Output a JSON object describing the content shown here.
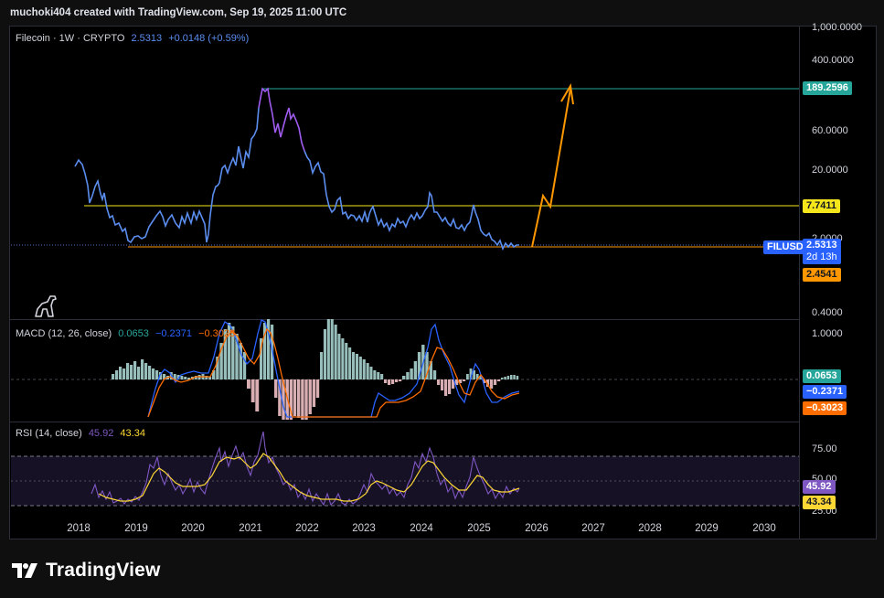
{
  "header": {
    "text": "muchoki404 created with TradingView.com, Sep 19, 2025 11:00 UTC"
  },
  "price_legend": {
    "symbol": "Filecoin · 1W · CRYPTO",
    "price": "2.5313",
    "change": "+0.0148 (+0.59%)"
  },
  "macd_legend": {
    "title": "MACD (12, 26, close)",
    "macd": "0.0653",
    "signal": "−0.2371",
    "hist": "−0.3023"
  },
  "rsi_legend": {
    "title": "RSI (14, close)",
    "rsi": "45.92",
    "ma": "43.34"
  },
  "price_axis": [
    "1,000.0000",
    "400.0000",
    "60.0000",
    "20.0000",
    "2.0000",
    "0.4000"
  ],
  "price_badges": {
    "target": "189.2596",
    "resistance": "7.7411",
    "symbol": "FILUSD",
    "last": "2.5313",
    "countdown": "2d 13h",
    "support": "2.4541"
  },
  "macd_axis": [
    "1.0000"
  ],
  "macd_badges": {
    "macd": "0.0653",
    "signal": "−0.2371",
    "hist": "−0.3023"
  },
  "rsi_axis": [
    "75.00",
    "50.00",
    "25.00"
  ],
  "rsi_badges": {
    "rsi": "45.92",
    "ma": "43.34"
  },
  "time_axis": [
    "2018",
    "2019",
    "2020",
    "2021",
    "2022",
    "2023",
    "2024",
    "2025",
    "2026",
    "2027",
    "2028",
    "2029",
    "2030"
  ],
  "brand": {
    "name": "TradingView"
  },
  "colors": {
    "price_line": "#5b8def",
    "price_line_peak": "#a05cf0",
    "target_line": "#26a69a",
    "resistance_line": "#f5e61c",
    "support_line": "#ff9800",
    "macd_line": "#2962ff",
    "signal_line": "#ff6d00",
    "hist_pos": "#b2dfdb",
    "hist_neg": "#ffcdd2",
    "rsi_line": "#7e57c2",
    "rsi_ma": "#fdd835"
  },
  "chart_data": {
    "type": "line",
    "symbol": "FILUSD",
    "timeframe": "1W",
    "scale": "log",
    "x": [
      "2018-04",
      "2018-07",
      "2018-10",
      "2019-01",
      "2019-04",
      "2019-07",
      "2019-10",
      "2020-01",
      "2020-04",
      "2020-07",
      "2020-10",
      "2021-01",
      "2021-03",
      "2021-04",
      "2021-06",
      "2021-09",
      "2021-11",
      "2022-01",
      "2022-04",
      "2022-07",
      "2022-10",
      "2023-01",
      "2023-04",
      "2023-07",
      "2023-10",
      "2024-01",
      "2024-03",
      "2024-06",
      "2024-09",
      "2024-12",
      "2025-03",
      "2025-06",
      "2025-09"
    ],
    "series": [
      {
        "values": [
          24,
          8,
          5,
          3.3,
          3.8,
          4.5,
          3.2,
          3.8,
          2.6,
          5.5,
          25,
          22,
          70,
          190,
          90,
          130,
          50,
          22,
          8,
          5.5,
          5,
          3.6,
          6,
          4,
          3.5,
          4,
          9.5,
          5,
          3.6,
          4.8,
          3,
          2.3,
          2.5313
        ]
      }
    ],
    "horizontal_levels": [
      189.2596,
      7.7411,
      2.4541
    ],
    "projection": [
      {
        "x": "2025-09",
        "y": 2.4541
      },
      {
        "x": "2026-01",
        "y": 9.5
      },
      {
        "x": "2026-02",
        "y": 6.5
      },
      {
        "x": "2026-08",
        "y": 189.2596
      }
    ],
    "ylim": [
      0.3,
      1200
    ]
  }
}
